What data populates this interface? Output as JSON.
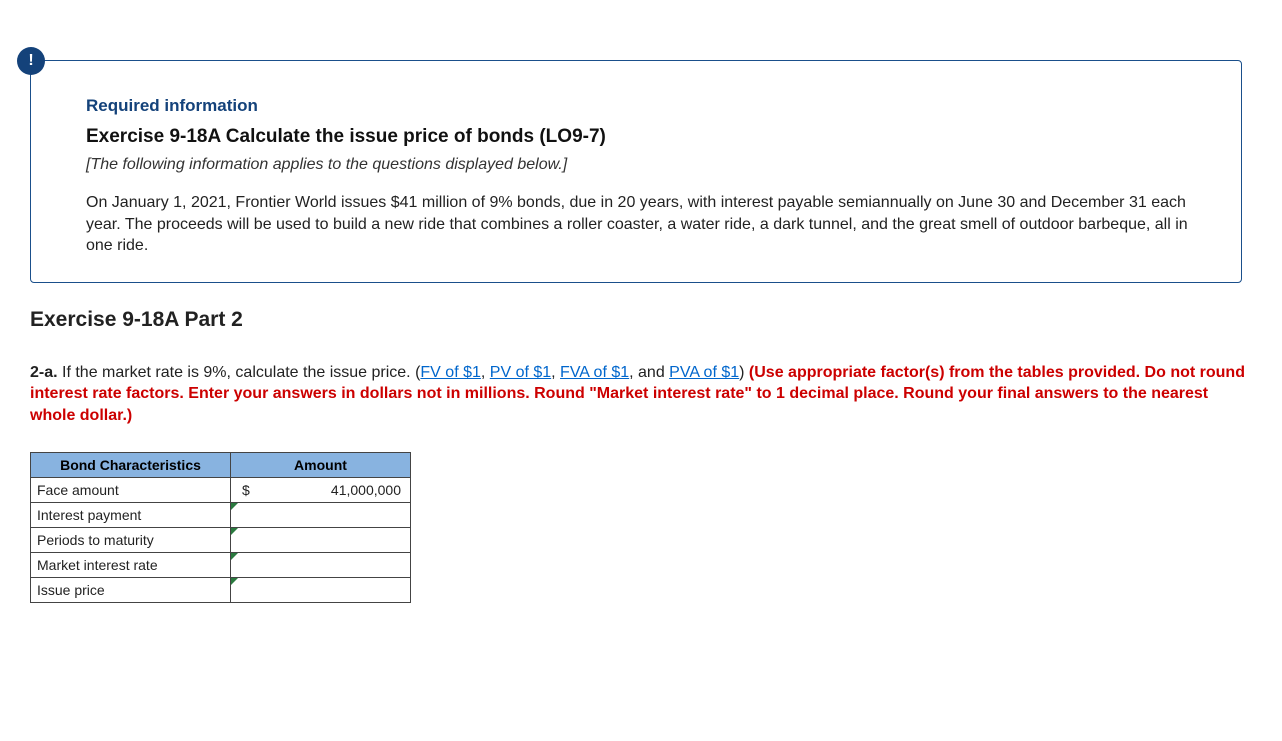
{
  "info": {
    "badge": "!",
    "required_label": "Required information",
    "exercise_title": "Exercise 9-18A Calculate the issue price of bonds (LO9-7)",
    "subtitle": "[The following information applies to the questions displayed below.]",
    "body": "On January 1, 2021, Frontier World issues $41 million of 9% bonds, due in 20 years, with interest payable semiannually on June 30 and December 31 each year. The proceeds will be used to build a new ride that combines a roller coaster, a water ride, a dark tunnel, and the great smell of outdoor barbeque, all in one ride."
  },
  "part_title": "Exercise 9-18A Part 2",
  "question": {
    "label": "2-a.",
    "text_before_links": " If the market rate is 9%, calculate the issue price. (",
    "links": {
      "fv": "FV of $1",
      "pv": "PV of $1",
      "fva": "FVA of $1",
      "pva": "PVA of $1"
    },
    "sep1": ", ",
    "sep2": ", ",
    "sep3": ", and ",
    "after_links": ") ",
    "red_text": "(Use appropriate factor(s) from the tables provided. Do not round interest rate factors. Enter your answers in dollars not in millions. Round \"Market interest rate\" to 1 decimal place. Round your final answers to the nearest whole dollar.)"
  },
  "table": {
    "headers": {
      "col1": "Bond Characteristics",
      "col2": "Amount"
    },
    "rows": {
      "face": {
        "label": "Face amount",
        "symbol": "$",
        "value": "41,000,000"
      },
      "interest": {
        "label": "Interest payment",
        "symbol": "",
        "value": ""
      },
      "periods": {
        "label": "Periods to maturity",
        "symbol": "",
        "value": ""
      },
      "market": {
        "label": "Market interest rate",
        "symbol": "",
        "value": ""
      },
      "issue": {
        "label": "Issue price",
        "symbol": "",
        "value": ""
      }
    }
  }
}
